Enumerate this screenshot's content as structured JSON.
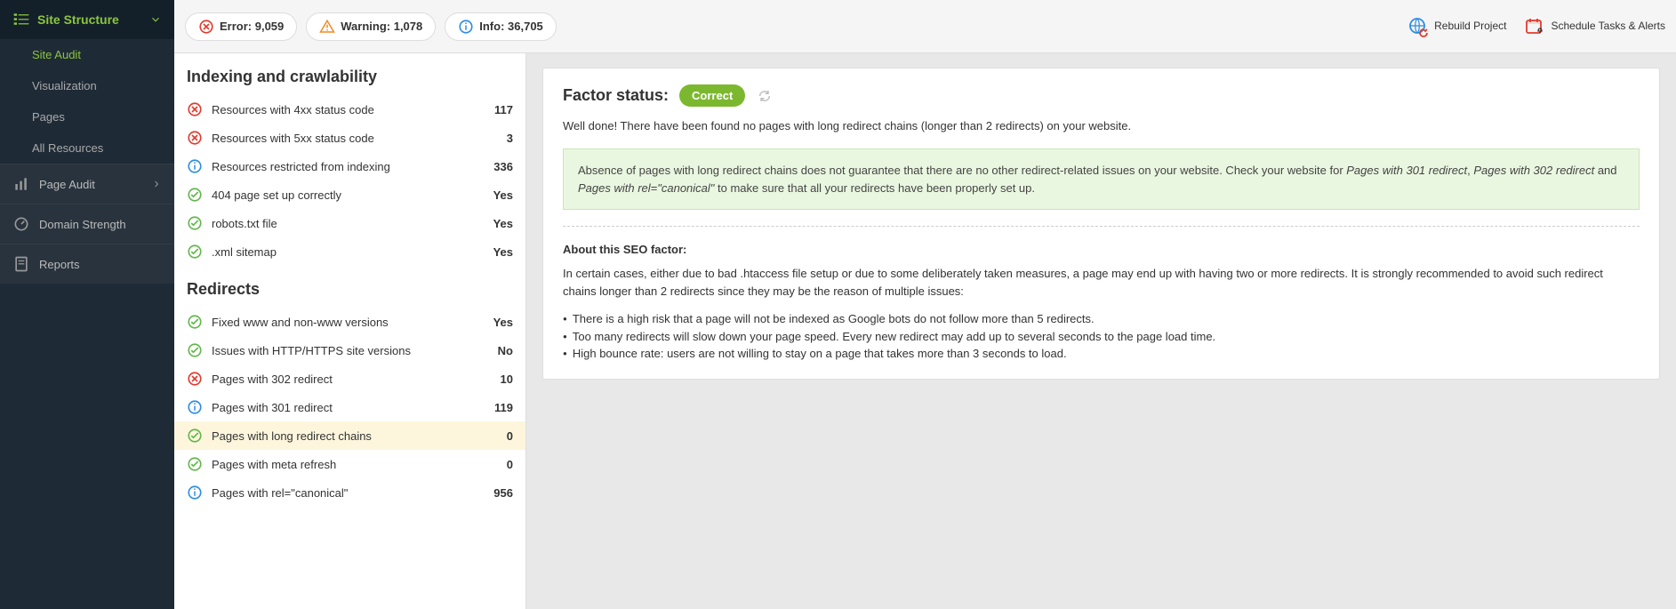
{
  "sidebar": {
    "site_structure": "Site Structure",
    "items": [
      "Site Audit",
      "Visualization",
      "Pages",
      "All Resources"
    ],
    "page_audit": "Page Audit",
    "domain_strength": "Domain Strength",
    "reports": "Reports"
  },
  "topbar": {
    "error_label": "Error: 9,059",
    "warning_label": "Warning: 1,078",
    "info_label": "Info: 36,705",
    "rebuild": "Rebuild Project",
    "schedule": "Schedule Tasks & Alerts"
  },
  "categories": [
    {
      "title": "Indexing and crawlability",
      "rows": [
        {
          "status": "error",
          "label": "Resources with 4xx status code",
          "value": "117"
        },
        {
          "status": "error",
          "label": "Resources with 5xx status code",
          "value": "3"
        },
        {
          "status": "info",
          "label": "Resources restricted from indexing",
          "value": "336"
        },
        {
          "status": "ok",
          "label": "404 page set up correctly",
          "value": "Yes"
        },
        {
          "status": "ok",
          "label": "robots.txt file",
          "value": "Yes"
        },
        {
          "status": "ok",
          "label": ".xml sitemap",
          "value": "Yes"
        }
      ]
    },
    {
      "title": "Redirects",
      "rows": [
        {
          "status": "ok",
          "label": "Fixed www and non-www versions",
          "value": "Yes"
        },
        {
          "status": "ok",
          "label": "Issues with HTTP/HTTPS site versions",
          "value": "No"
        },
        {
          "status": "error",
          "label": "Pages with 302 redirect",
          "value": "10"
        },
        {
          "status": "info",
          "label": "Pages with 301 redirect",
          "value": "119"
        },
        {
          "status": "ok",
          "label": "Pages with long redirect chains",
          "value": "0",
          "selected": true
        },
        {
          "status": "ok",
          "label": "Pages with meta refresh",
          "value": "0"
        },
        {
          "status": "info",
          "label": "Pages with rel=\"canonical\"",
          "value": "956"
        }
      ]
    }
  ],
  "detail": {
    "factor_status_label": "Factor status:",
    "badge": "Correct",
    "well_done": "Well done! There have been found no pages with long redirect chains (longer than 2 redirects) on your website.",
    "note_p1a": "Absence of pages with long redirect chains does not guarantee that there are no other redirect-related issues on your website. Check your website for ",
    "note_i1": "Pages with 301 redirect",
    "note_p1b": ", ",
    "note_i2": "Pages with 302 redirect",
    "note_p1c": " and ",
    "note_i3": "Pages with rel=\"canonical\"",
    "note_p1d": "  to make sure that all your redirects have been properly set up.",
    "about_head": "About this SEO factor:",
    "about_p": "In certain cases, either due to bad .htaccess file setup or due to some deliberately taken measures, a page may end up with having two or more redirects. It is strongly recommended to avoid such redirect chains longer than 2 redirects since they may be the reason of multiple issues:",
    "bullets": [
      "There is a high risk that a page will not be indexed as Google bots do not follow more than 5 redirects.",
      "Too many redirects will slow down your page speed. Every new redirect may add up to several seconds to the page load time.",
      "High bounce rate: users are not willing to stay on a page that takes more than 3 seconds to load."
    ]
  },
  "colors": {
    "green": "#8cc63e",
    "ok": "#63b74b",
    "error": "#e23b2e",
    "info": "#2e8de2",
    "warn": "#f08a24"
  }
}
